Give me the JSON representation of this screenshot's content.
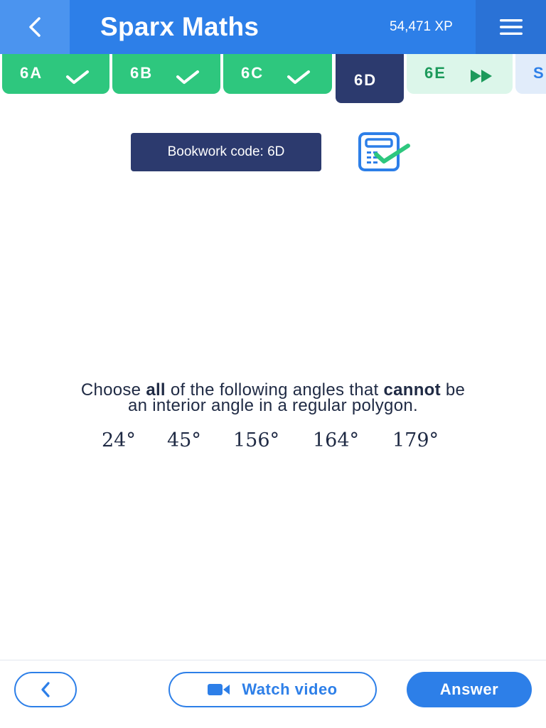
{
  "header": {
    "title": "Sparx Maths",
    "xp": "54,471 XP"
  },
  "tabs": [
    {
      "label": "6A",
      "status": "complete"
    },
    {
      "label": "6B",
      "status": "complete"
    },
    {
      "label": "6C",
      "status": "complete"
    },
    {
      "label": "6D",
      "status": "current"
    },
    {
      "label": "6E",
      "status": "next"
    },
    {
      "label": "S",
      "status": "peek"
    }
  ],
  "bookwork": {
    "label": "Bookwork code: 6D"
  },
  "question": {
    "part1": "Choose ",
    "bold1": "all",
    "part2": " of the following angles that ",
    "bold2": "cannot",
    "part3": " be",
    "line2": "an interior angle in a regular polygon.",
    "options": [
      "24°",
      "45°",
      "156°",
      "164°",
      "179°"
    ]
  },
  "footer": {
    "watch_video": "Watch video",
    "answer": "Answer"
  },
  "colors": {
    "header_blue": "#2d7fe8",
    "tab_done_green": "#2ec77e",
    "tab_current_navy": "#2c3a6e",
    "tab_next_bg": "#dcf6ea",
    "text_dark": "#1f2a44"
  },
  "icons": {
    "back": "chevron-left-icon",
    "menu": "hamburger-menu-icon",
    "tab_check": "check-icon",
    "tab_next": "fast-forward-icon",
    "bookwork": "bookwork-check-icon",
    "video": "video-camera-icon"
  }
}
